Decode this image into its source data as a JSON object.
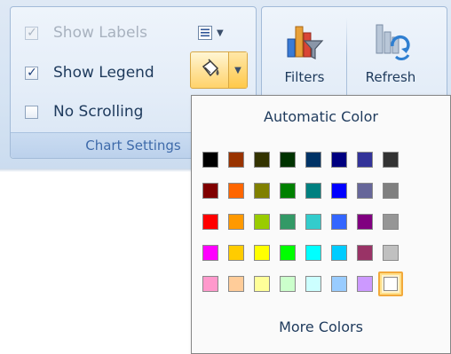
{
  "ribbon": {
    "chart_settings_group": {
      "label": "Chart Settings",
      "show_labels": {
        "label": "Show Labels",
        "checked": true,
        "enabled": false
      },
      "show_legend": {
        "label": "Show Legend",
        "checked": true,
        "enabled": true
      },
      "no_scrolling": {
        "label": "No Scrolling",
        "checked": false,
        "enabled": true
      },
      "labels_format_icon": "list-format-icon",
      "fill_color_icon": "paint-bucket-icon"
    },
    "tools_group": {
      "filters_label": "Filters",
      "refresh_label": "Refresh",
      "filters_icon": "chart-filter-icon",
      "refresh_icon": "chart-refresh-icon"
    }
  },
  "color_popup": {
    "title": "Automatic Color",
    "footer": "More Colors",
    "selected_color": "#FFFFFF",
    "swatches": [
      [
        "#000000",
        "#993300",
        "#333300",
        "#003300",
        "#003366",
        "#000080",
        "#333399",
        "#333333"
      ],
      [
        "#800000",
        "#FF6600",
        "#808000",
        "#008000",
        "#008080",
        "#0000FF",
        "#666699",
        "#808080"
      ],
      [
        "#FF0000",
        "#FF9900",
        "#99CC00",
        "#339966",
        "#33CCCC",
        "#3366FF",
        "#800080",
        "#969696"
      ],
      [
        "#FF00FF",
        "#FFCC00",
        "#FFFF00",
        "#00FF00",
        "#00FFFF",
        "#00CCFF",
        "#993366",
        "#C0C0C0"
      ],
      [
        "#FF99CC",
        "#FFCC99",
        "#FFFF99",
        "#CCFFCC",
        "#CCFFFF",
        "#99CCFF",
        "#CC99FF",
        "#FFFFFF"
      ]
    ]
  }
}
